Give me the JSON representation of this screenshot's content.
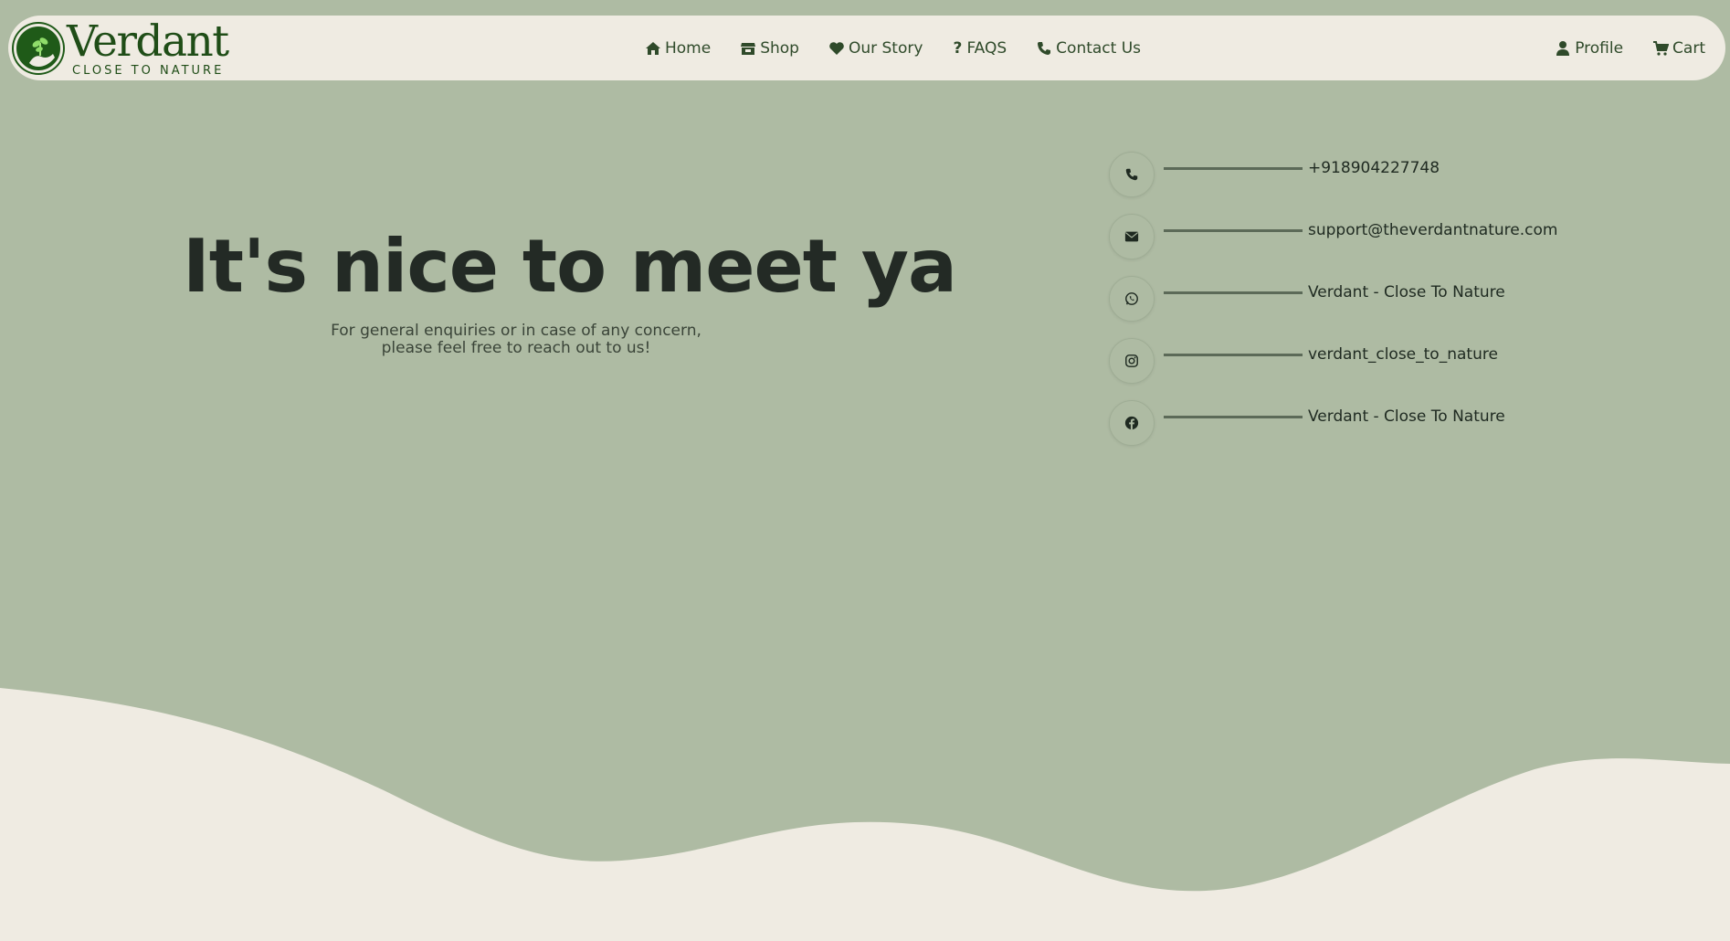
{
  "brand": {
    "name": "Verdant",
    "tagline": "CLOSE TO NATURE"
  },
  "nav": {
    "left": [
      {
        "label": "Home",
        "icon": "home-icon"
      },
      {
        "label": "Shop",
        "icon": "store-icon"
      },
      {
        "label": "Our Story",
        "icon": "heart-icon"
      },
      {
        "label": "FAQS",
        "icon": "question-icon"
      },
      {
        "label": "Contact Us",
        "icon": "phone-icon"
      }
    ],
    "right": [
      {
        "label": "Profile",
        "icon": "user-icon"
      },
      {
        "label": "Cart",
        "icon": "cart-icon"
      }
    ]
  },
  "hero": {
    "title": "It's nice to meet ya",
    "subtitle_line1": "For general enquiries or in case of any concern,",
    "subtitle_line2": "please feel free to reach out to us!"
  },
  "contacts": [
    {
      "type": "phone",
      "icon": "phone-icon",
      "value": "+918904227748"
    },
    {
      "type": "email",
      "icon": "envelope-icon",
      "value": "support@theverdantnature.com"
    },
    {
      "type": "whatsapp",
      "icon": "whatsapp-icon",
      "value": "Verdant - Close To Nature"
    },
    {
      "type": "instagram",
      "icon": "instagram-icon",
      "value": "verdant_close_to_nature"
    },
    {
      "type": "facebook",
      "icon": "facebook-icon",
      "value": "Verdant - Close To Nature"
    }
  ],
  "colors": {
    "background": "#aebba3",
    "cream": "#efebe2",
    "brand_green": "#1f4d17",
    "text_dark": "#232a25"
  }
}
